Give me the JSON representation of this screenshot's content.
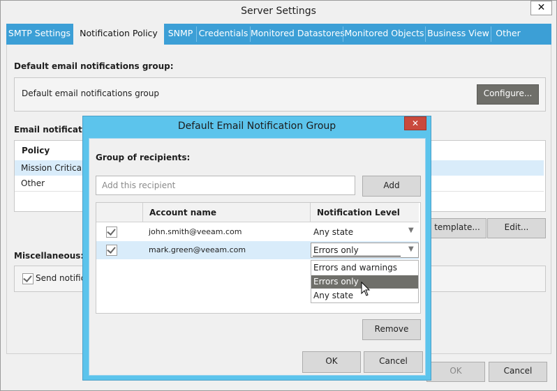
{
  "window": {
    "title": "Server Settings",
    "close_glyph": "✕"
  },
  "tabs": [
    "SMTP Settings",
    "Notification Policy",
    "SNMP",
    "Credentials",
    "Monitored Datastores",
    "Monitored Objects",
    "Business View",
    "Other"
  ],
  "selected_tab": "Notification Policy",
  "policy": {
    "default_group_heading": "Default email notifications group:",
    "default_group_text": "Default email notifications group",
    "configure_label": "Configure...",
    "email_heading": "Email notificatio",
    "policy_col": "Policy",
    "rows": [
      "Mission Critical",
      "Other"
    ],
    "template_label": "template...",
    "edit_label": "Edit...",
    "misc_heading": "Miscellaneous:",
    "send_label": "Send notifica",
    "ok_label": "OK",
    "cancel_label": "Cancel"
  },
  "dialog": {
    "title": "Default Email Notification Group",
    "close_glyph": "✕",
    "group_label": "Group of recipients:",
    "recipient_placeholder": "Add this recipient",
    "add_label": "Add",
    "col_account": "Account name",
    "col_level": "Notification Level",
    "recipients": [
      {
        "account": "john.smith@veeam.com",
        "level": "Any state",
        "checked": true
      },
      {
        "account": "mark.green@veeam.com",
        "level": "Errors only",
        "checked": true
      }
    ],
    "dropdown_options": [
      "Errors and warnings",
      "Errors only",
      "Any state"
    ],
    "dropdown_selected": "Errors only",
    "remove_label": "Remove",
    "ok_label": "OK",
    "cancel_label": "Cancel"
  },
  "colors": {
    "accent": "#3c9fd6",
    "dialog_frame": "#5cc4ec",
    "selection": "#d9ecfa",
    "button_dark": "#6f6f6a",
    "close_red": "#c94a3d"
  }
}
